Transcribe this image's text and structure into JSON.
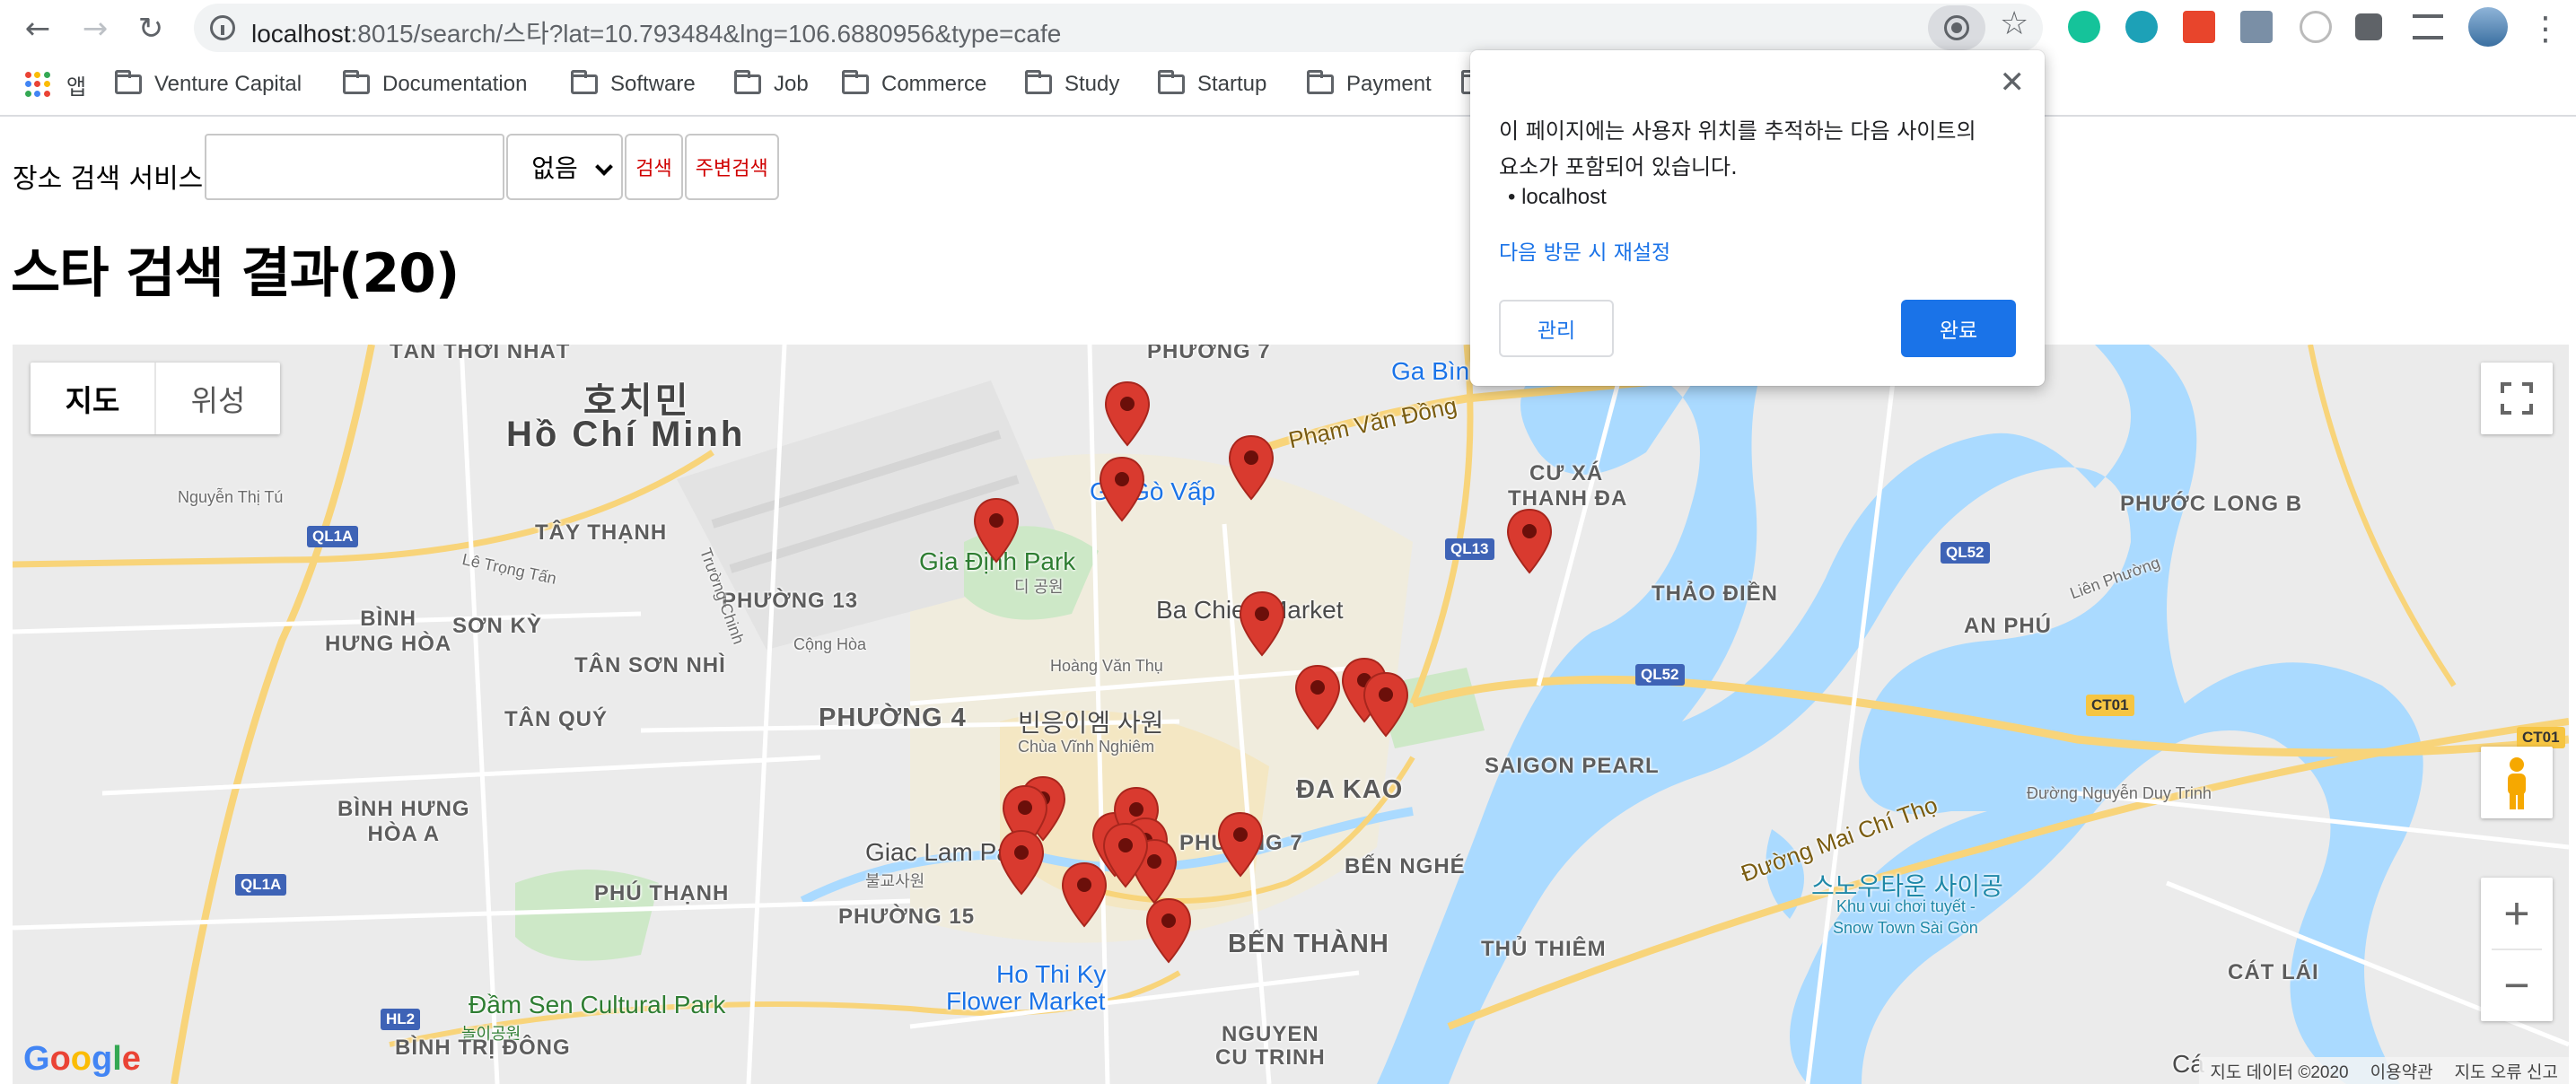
{
  "browser": {
    "url_host": "localhost",
    "url_rest": ":8015/search/스타?lat=10.793484&lng=106.6880956&type=cafe",
    "bookmarks": [
      "앱",
      "Venture Capital",
      "Documentation",
      "Software",
      "Job",
      "Commerce",
      "Study",
      "Startup",
      "Payment"
    ]
  },
  "page": {
    "service_label": "장소 검색 서비스",
    "query_value": "",
    "type_selected": "없음",
    "search_button": "검색",
    "nearby_button": "주변검색",
    "results_title": "스타 검색 결과(20)"
  },
  "map": {
    "type_map": "지도",
    "type_satellite": "위성",
    "google_logo": "Google",
    "attribution": [
      "지도 데이터 ©2020",
      "이용약관",
      "지도 오류 신고"
    ],
    "labels": {
      "tan_thoi_nhat": "TÂN THỚI NHẤT",
      "hcm_ko": "호치민",
      "hcm": "Hồ Chí Minh",
      "phuong7_top": "PHƯỜNG 7",
      "ga_binh": "Ga Bình",
      "pham_van_dong": "Phạm Văn Đồng",
      "go_vap": "Ga Gò Vấp",
      "cu_xa": "CƯ XÁ",
      "thanh_da": "THANH ĐA",
      "phuoc_long_b": "PHƯỚC LONG B",
      "nguyen_thi_tu": "Nguyễn Thị Tú",
      "tay_thanh": "TÂY THẠNH",
      "gia_dinh_park": "Gia Định Park",
      "park_ko": "디 공원",
      "thao_dien": "THẢO ĐIỀN",
      "binh_hung_hoa": "BÌNH\nHƯNG HÒA",
      "son_ky": "SƠN KỲ",
      "phuong13": "PHƯỜNG 13",
      "ba_chieu": "Ba Chieu Market",
      "an_phu": "AN PHÚ",
      "tan_son_nhi": "TÂN SƠN NHÌ",
      "tan_quy": "TÂN QUÝ",
      "phuong4": "PHƯỜNG 4",
      "vinh_nghiem_ko": "빈응이엠 사원",
      "vinh_nghiem": "Chùa Vĩnh Nghiêm",
      "da_kao": "ĐA KAO",
      "saigon_pearl": "SAIGON PEARL",
      "binh_hung_hoa_a": "BÌNH HƯNG\nHÒA A",
      "giac_lam": "Giac Lam Pag",
      "giac_lam_ko": "불교사원",
      "phuong7_mid": "PHƯỜNG 7",
      "ben_nghe": "BẾN NGHÉ",
      "phu_thanh": "PHÚ THẠNH",
      "phuong15": "PHƯỜNG 15",
      "ben_thanh": "BẾN THÀNH",
      "thu_thiem": "THỦ THIÊM",
      "snow_ko": "스노우타운 사이공",
      "snow_vi": "Khu vui chơi tuyết -",
      "snow_en": "Snow Town Sài Gòn",
      "mai_chi_tho": "Đường Mai Chí Thọ",
      "dam_sen": "Đầm Sen Cultural Park",
      "dam_sen_ko": "놀이공원",
      "ho_thi_ky": "Ho Thi Ky",
      "flower_market": "Flower Market",
      "cat_lai": "CÁT LÁI",
      "binh_tri_dong": "BÌNH TRỊ ĐÔNG",
      "nguyen_cu_trinh": "NGUYEN\nCU TRINH",
      "lien_phuong": "Liên Phường",
      "nguyen_duy_trinh": "Đường Nguyễn Duy Trinh",
      "hoang_van_thu": "Hoàng Văn Thụ",
      "truong_chinh": "Trường Chinh",
      "le_trong_tan": "Lê Trọng Tấn",
      "cong_hoa": "Cộng Hòa",
      "ca": "Cá"
    },
    "shields": [
      "QL1A",
      "QL13",
      "QL52",
      "QL52",
      "CT01",
      "CT01",
      "QL1A",
      "HL2"
    ],
    "marker_count": 20
  },
  "popup": {
    "message": "이 페이지에는 사용자 위치를 추적하는 다음 사이트의 요소가 포함되어 있습니다.",
    "site": "localhost",
    "reset_link": "다음 방문 시 재설정",
    "manage": "관리",
    "done": "완료"
  },
  "colors": {
    "accent": "#1a73e8",
    "marker": "#d93a2f",
    "water": "#aadaff",
    "road_major": "#f8d47a"
  }
}
